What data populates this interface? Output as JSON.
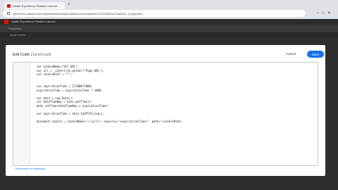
{
  "browser": {
    "tab_title": "Adobe Experience Platform Launch",
    "url": "experience.adobe.com/#/@adobelaunchtest145/launch/companies/CO0c7b6631d74ab404.../properties/..."
  },
  "app": {
    "title": "Adobe Experience Platform Launch",
    "toolbar_label": "Properties",
    "search_placeholder": "",
    "audit_label": "Audit Events"
  },
  "modal": {
    "title": "Edit Code",
    "lang": "[JavaScript]",
    "cancel_label": "Cancel",
    "save_label": "Save",
    "code": "  var cookieName=\"ECC-URL\";\n  var url = _satellite.getVar(\"Page URL\");\n  var cookiePath = \"/\";\n\n\n  var expirationTime = 172800*1000;\n  expirationTime = expirationTime * 1000;\n\n  var date = new Date();\n  var dateTimeNow = date.getTime();\n  date.setTime(dateTimeNow + expirationTime);\n\n  var expirationTime = date.toUTCString();\n\n  document.cookie = cookieName+\"=\"+url+\"; expires=\"+expirationTime+\"; path=\"+cookiePath;",
    "warning_link": "Reconnect on warnings"
  },
  "colors": {
    "accent": "#1473e6",
    "brand": "#eb1000"
  }
}
